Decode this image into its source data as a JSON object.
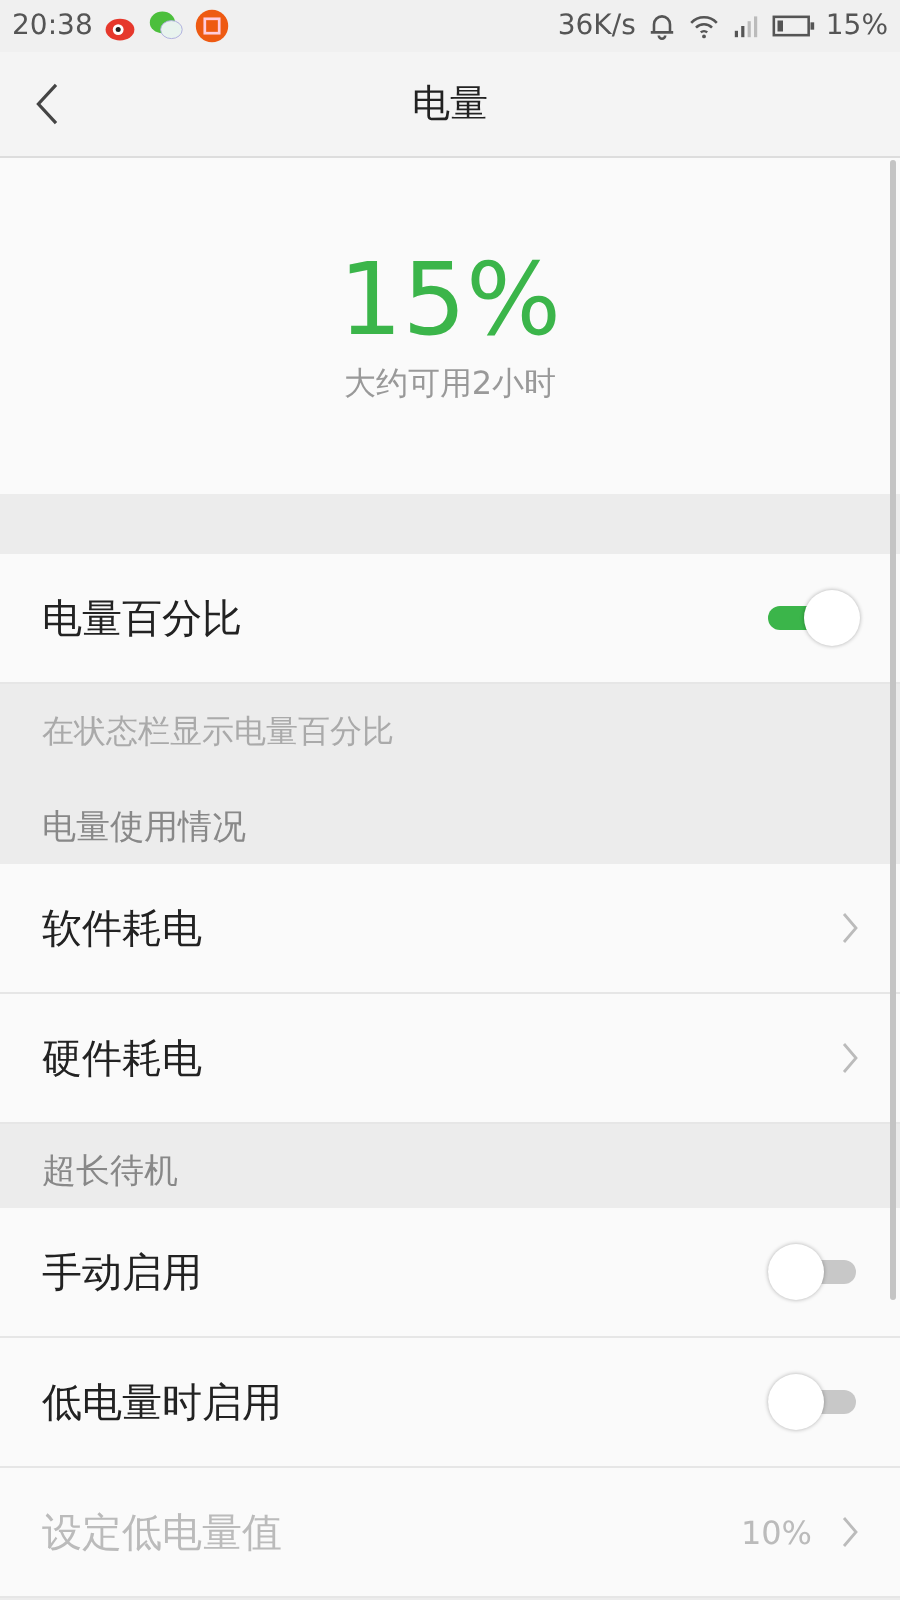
{
  "status_bar": {
    "time": "20:38",
    "speed": "36K/s",
    "battery": "15%"
  },
  "header": {
    "title": "电量"
  },
  "summary": {
    "percent": "15%",
    "estimate": "大约可用2小时"
  },
  "items": [
    {
      "kind": "gap"
    },
    {
      "kind": "toggle",
      "label": "电量百分比",
      "on": true,
      "disabled": false
    },
    {
      "kind": "note",
      "label": "在状态栏显示电量百分比"
    },
    {
      "kind": "section",
      "label": "电量使用情况"
    },
    {
      "kind": "link",
      "label": "软件耗电",
      "disabled": false
    },
    {
      "kind": "link",
      "label": "硬件耗电",
      "disabled": false
    },
    {
      "kind": "section",
      "label": "超长待机"
    },
    {
      "kind": "toggle",
      "label": "手动启用",
      "on": false,
      "disabled": false
    },
    {
      "kind": "toggle",
      "label": "低电量时启用",
      "on": false,
      "disabled": false
    },
    {
      "kind": "link",
      "label": "设定低电量值",
      "value": "10%",
      "disabled": true
    }
  ]
}
